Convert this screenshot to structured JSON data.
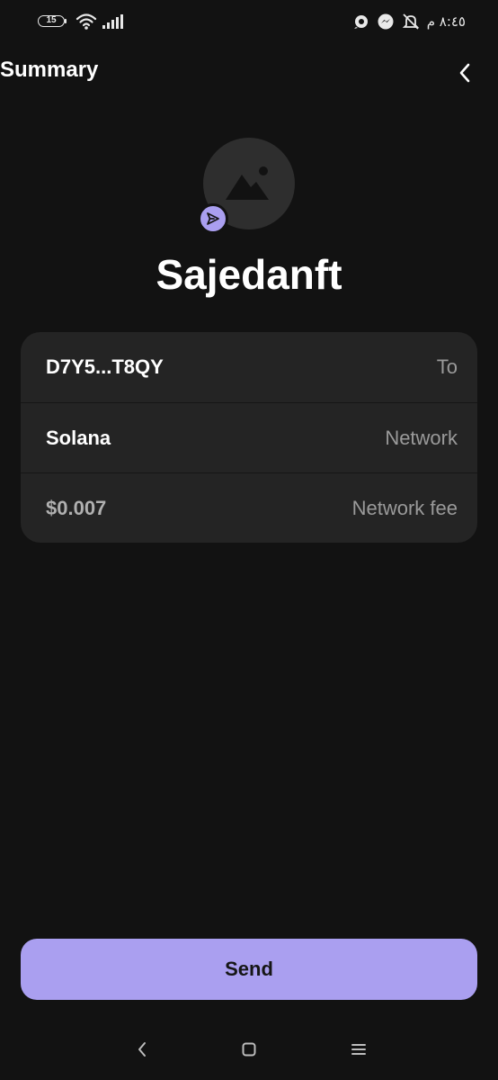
{
  "status_bar": {
    "battery_level": "15",
    "time": "٨:٤٥ م",
    "icons": [
      "battery-icon",
      "wifi-icon",
      "signal-icon",
      "notification-muted-icon",
      "messenger-icon",
      "chat-icon"
    ]
  },
  "header": {
    "title": "Summary",
    "back_icon": "chevron-right-icon"
  },
  "nft": {
    "collection_name": "Sajedanft",
    "avatar_icon": "image-placeholder-icon",
    "badge_icon": "send-icon"
  },
  "details": [
    {
      "value": "D7Y5...T8QY",
      "label": "To"
    },
    {
      "value": "Solana",
      "label": "Network"
    },
    {
      "value": "$0.007",
      "label": "Network fee"
    }
  ],
  "actions": {
    "send_label": "Send"
  },
  "nav_bar": {
    "icons": [
      "back-nav-icon",
      "home-nav-icon",
      "recents-nav-icon"
    ]
  },
  "colors": {
    "background": "#121212",
    "card": "#242424",
    "accent": "#aa9ff0",
    "avatar_bg": "#2e2e2e"
  }
}
